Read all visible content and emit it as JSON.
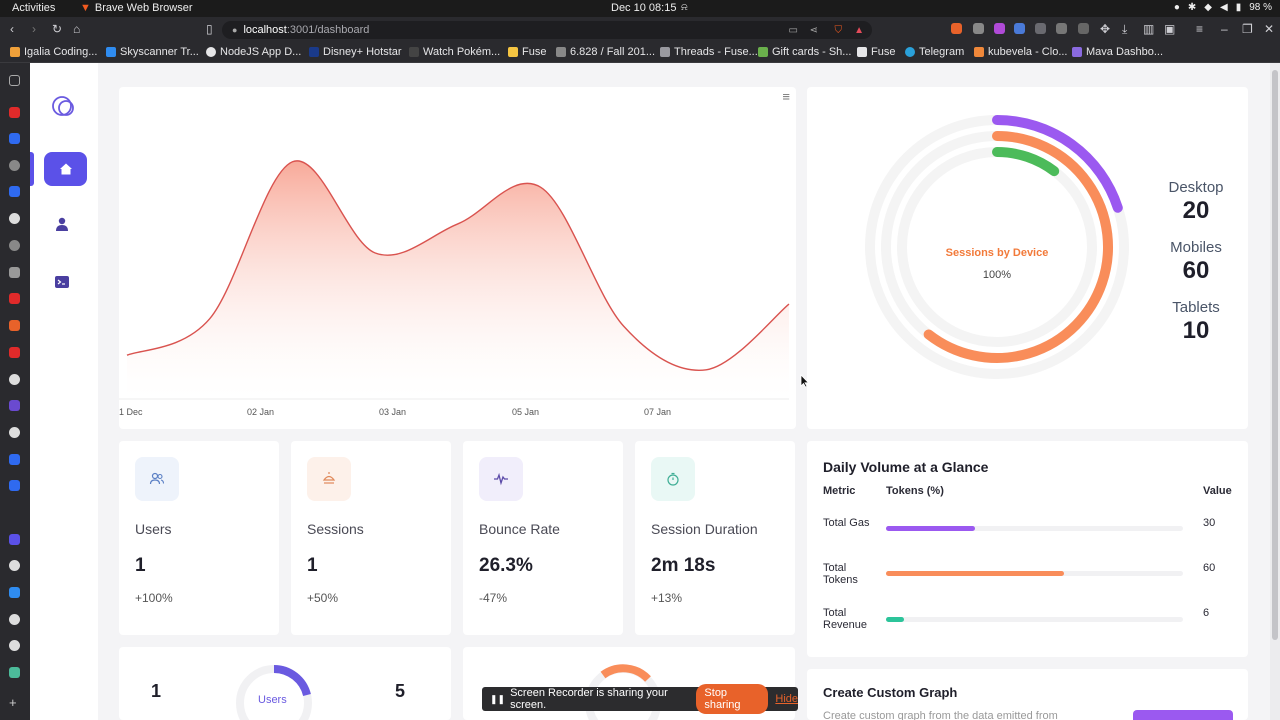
{
  "system": {
    "activities": "Activities",
    "app_name": "Brave Web Browser",
    "clock": "Dec 10  08:15",
    "battery": "98 %"
  },
  "browser": {
    "url_host": "localhost",
    "url_path": ":3001/dashboard",
    "bookmarks": [
      "Igalia Coding...",
      "Skyscanner Tr...",
      "NodeJS App D...",
      "Disney+ Hotstar",
      "Watch Pokém...",
      "Fuse",
      "6.828 / Fall 201...",
      "Threads - Fuse...",
      "Gift cards - Sh...",
      "Fuse",
      "Telegram",
      "kubevela - Clo...",
      "Mava Dashbo..."
    ]
  },
  "chart_data": {
    "type": "area",
    "x_ticks": [
      "1 Dec",
      "02 Jan",
      "03 Jan",
      "05 Jan",
      "07 Jan"
    ],
    "values": [
      12,
      22,
      65,
      40,
      48,
      58,
      20,
      8,
      26
    ],
    "ylim": [
      0,
      80
    ],
    "color": "#d9534f"
  },
  "device": {
    "center_title": "Sessions by Device",
    "center_value": "100%",
    "items": [
      {
        "label": "Desktop",
        "value": "20",
        "color": "#9b59f0",
        "fraction": 0.2
      },
      {
        "label": "Mobiles",
        "value": "60",
        "color": "#f98d5a",
        "fraction": 0.6
      },
      {
        "label": "Tablets",
        "value": "10",
        "color": "#4cbb5a",
        "fraction": 0.1
      }
    ]
  },
  "stats": [
    {
      "title": "Users",
      "value": "1",
      "change": "+100%",
      "icon": "users-icon",
      "icon_bg": "#eef3fb",
      "icon_color": "#5a7fc4"
    },
    {
      "title": "Sessions",
      "value": "1",
      "change": "+50%",
      "icon": "lamp-icon",
      "icon_bg": "#fdf1ea",
      "icon_color": "#e0895a"
    },
    {
      "title": "Bounce Rate",
      "value": "26.3%",
      "change": "-47%",
      "icon": "pulse-icon",
      "icon_bg": "#f1eefb",
      "icon_color": "#5b4aa8"
    },
    {
      "title": "Session Duration",
      "value": "2m 18s",
      "change": "+13%",
      "icon": "timer-icon",
      "icon_bg": "#e9f8f5",
      "icon_color": "#3fae95"
    }
  ],
  "daily": {
    "title": "Daily Volume at a Glance",
    "col_metric": "Metric",
    "col_tokens": "Tokens (%)",
    "col_value": "Value",
    "rows": [
      {
        "label": "Total Gas",
        "value": "30",
        "fraction": 0.3,
        "color": "#9b59f0"
      },
      {
        "label": "Total Tokens",
        "value": "60",
        "fraction": 0.6,
        "color": "#f98d5a"
      },
      {
        "label": "Total Revenue",
        "value": "6",
        "fraction": 0.06,
        "color": "#2cc49a"
      }
    ]
  },
  "bottom": {
    "left_value": "1",
    "donut_label": "Users",
    "right_value": "5",
    "custom_title": "Create Custom Graph",
    "custom_desc": "Create custom graph from the data emitted from"
  },
  "share": {
    "text": "Screen Recorder is sharing your screen.",
    "stop": "Stop sharing",
    "hide": "Hide"
  }
}
